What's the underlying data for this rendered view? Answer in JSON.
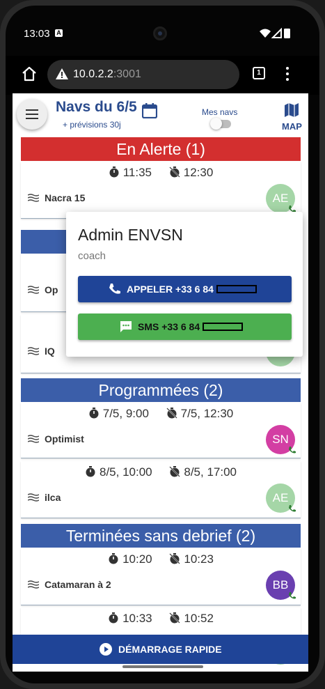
{
  "status": {
    "time": "13:03"
  },
  "browser": {
    "url_host": "10.0.2.2",
    "url_port": ":3001",
    "tab_count": "1"
  },
  "header": {
    "title": "Navs du 6/5",
    "subtitle": "+ prévisions 30j",
    "toggle_label": "Mes navs",
    "map_label": "MAP"
  },
  "sections": {
    "alert": "En Alerte (1)",
    "scheduled": "Programmées (2)",
    "finished": "Terminées sans debrief (2)"
  },
  "alert_card": {
    "start": "11:35",
    "end": "12:30",
    "boat": "Nacra 15",
    "avatar": "AE"
  },
  "hidden_cards": [
    {
      "boat": "Op"
    },
    {
      "boat": "IQ"
    }
  ],
  "scheduled_cards": [
    {
      "start": "7/5, 9:00",
      "end": "7/5, 12:30",
      "boat": "Optimist",
      "avatar": "SN"
    },
    {
      "start": "8/5, 10:00",
      "end": "8/5, 17:00",
      "boat": "ilca",
      "avatar": "AE"
    }
  ],
  "finished_cards": [
    {
      "start": "10:20",
      "end": "10:23",
      "boat": "Catamaran à 2",
      "avatar": "BB"
    },
    {
      "start": "10:33",
      "end": "10:52",
      "boat": ""
    }
  ],
  "popover": {
    "name": "Admin ENVSN",
    "role": "coach",
    "call_label": "APPELER +33 6 84",
    "sms_label": "SMS +33 6 84"
  },
  "quick_start": "DÉMARRAGE RAPIDE",
  "colors": {
    "primary": "#1f4497",
    "alert": "#d32f2f",
    "section": "#3b5ea9",
    "sms": "#4caf50",
    "avatar_ae": "#a5d6a7",
    "avatar_sn": "#d33ea3",
    "avatar_bb": "#6a3fb0"
  }
}
